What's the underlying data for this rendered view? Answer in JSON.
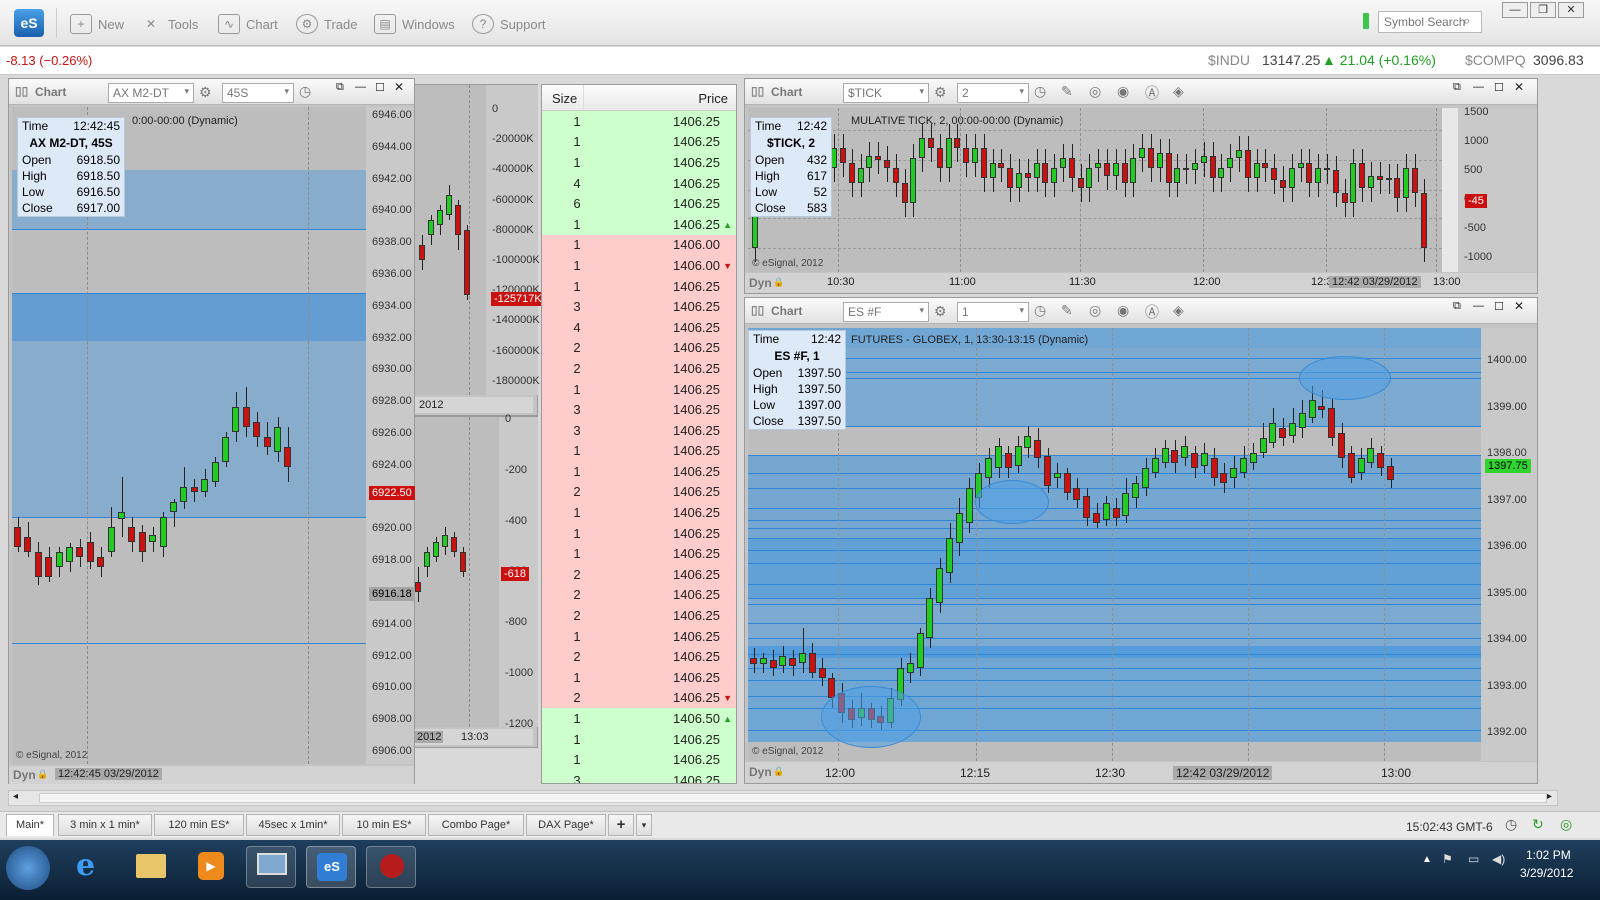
{
  "toolbar": {
    "logo": "eS",
    "buttons": [
      {
        "label": "New",
        "icon": "new-icon"
      },
      {
        "label": "Tools",
        "icon": "tools-icon"
      },
      {
        "label": "Chart",
        "icon": "chart-icon"
      },
      {
        "label": "Trade",
        "icon": "trade-icon"
      },
      {
        "label": "Windows",
        "icon": "windows-icon"
      },
      {
        "label": "Support",
        "icon": "support-icon"
      }
    ],
    "search_placeholder": "Symbol Search"
  },
  "ticker": {
    "left_change": "-8.13 (−0.26%)",
    "indu_symbol": "$INDU",
    "indu_value": "13147.25",
    "indu_change": "▲ 21.04 (+0.16%)",
    "compq_symbol": "$COMPQ",
    "compq_value": "3096.83"
  },
  "chart_left": {
    "header": "Chart",
    "symbol": "AX M2-DT",
    "interval": "45S",
    "subtitle": "0:00-00:00 (Dynamic)",
    "info": {
      "time_label": "Time",
      "time": "12:42:45",
      "title": "AX M2-DT, 45S",
      "open_label": "Open",
      "open": "6918.50",
      "high_label": "High",
      "high": "6918.50",
      "low_label": "Low",
      "low": "6916.50",
      "close_label": "Close",
      "close": "6917.00"
    },
    "y_ticks": [
      "6946.00",
      "6944.00",
      "6942.00",
      "6940.00",
      "6938.00",
      "6936.00",
      "6934.00",
      "6932.00",
      "6930.00",
      "6928.00",
      "6926.00",
      "6924.00",
      "6922.00",
      "6920.00",
      "6918.00",
      "6916.00",
      "6914.00",
      "6912.00",
      "6910.00",
      "6908.00",
      "6906.00"
    ],
    "last_price": "6922.50",
    "cursor_price": "6916.18",
    "copyright": "© eSignal, 2012",
    "dyn": "Dyn",
    "cursor_time": "12:42:45 03/29/2012"
  },
  "chart_mid_top": {
    "y_ticks": [
      "0",
      "-20000K",
      "-40000K",
      "-60000K",
      "-80000K",
      "-100000K",
      "-120000K",
      "-140000K",
      "-160000K",
      "-180000K"
    ],
    "last_value": "-125717K",
    "x_label": "2012"
  },
  "chart_mid_bottom": {
    "y_ticks": [
      "0",
      "-200",
      "-400",
      "-600",
      "-800",
      "-1000",
      "-1200"
    ],
    "last_value": "-618",
    "x_labels": [
      "2012",
      "13:03"
    ]
  },
  "dom": {
    "size_header": "Size",
    "price_header": "Price",
    "rows": [
      {
        "size": "1",
        "price": "1406.25",
        "side": "bid",
        "arrow": ""
      },
      {
        "size": "1",
        "price": "1406.25",
        "side": "bid",
        "arrow": ""
      },
      {
        "size": "1",
        "price": "1406.25",
        "side": "bid",
        "arrow": ""
      },
      {
        "size": "4",
        "price": "1406.25",
        "side": "bid",
        "arrow": ""
      },
      {
        "size": "6",
        "price": "1406.25",
        "side": "bid",
        "arrow": ""
      },
      {
        "size": "1",
        "price": "1406.25",
        "side": "bid",
        "arrow": "up"
      },
      {
        "size": "1",
        "price": "1406.00",
        "side": "ask",
        "arrow": ""
      },
      {
        "size": "1",
        "price": "1406.00",
        "side": "ask",
        "arrow": "down"
      },
      {
        "size": "1",
        "price": "1406.25",
        "side": "ask",
        "arrow": ""
      },
      {
        "size": "3",
        "price": "1406.25",
        "side": "ask",
        "arrow": ""
      },
      {
        "size": "4",
        "price": "1406.25",
        "side": "ask",
        "arrow": ""
      },
      {
        "size": "2",
        "price": "1406.25",
        "side": "ask",
        "arrow": ""
      },
      {
        "size": "2",
        "price": "1406.25",
        "side": "ask",
        "arrow": ""
      },
      {
        "size": "1",
        "price": "1406.25",
        "side": "ask",
        "arrow": ""
      },
      {
        "size": "3",
        "price": "1406.25",
        "side": "ask",
        "arrow": ""
      },
      {
        "size": "3",
        "price": "1406.25",
        "side": "ask",
        "arrow": ""
      },
      {
        "size": "1",
        "price": "1406.25",
        "side": "ask",
        "arrow": ""
      },
      {
        "size": "1",
        "price": "1406.25",
        "side": "ask",
        "arrow": ""
      },
      {
        "size": "2",
        "price": "1406.25",
        "side": "ask",
        "arrow": ""
      },
      {
        "size": "1",
        "price": "1406.25",
        "side": "ask",
        "arrow": ""
      },
      {
        "size": "1",
        "price": "1406.25",
        "side": "ask",
        "arrow": ""
      },
      {
        "size": "1",
        "price": "1406.25",
        "side": "ask",
        "arrow": ""
      },
      {
        "size": "2",
        "price": "1406.25",
        "side": "ask",
        "arrow": ""
      },
      {
        "size": "2",
        "price": "1406.25",
        "side": "ask",
        "arrow": ""
      },
      {
        "size": "2",
        "price": "1406.25",
        "side": "ask",
        "arrow": ""
      },
      {
        "size": "1",
        "price": "1406.25",
        "side": "ask",
        "arrow": ""
      },
      {
        "size": "2",
        "price": "1406.25",
        "side": "ask",
        "arrow": ""
      },
      {
        "size": "1",
        "price": "1406.25",
        "side": "ask",
        "arrow": ""
      },
      {
        "size": "2",
        "price": "1406.25",
        "side": "ask",
        "arrow": "down"
      },
      {
        "size": "1",
        "price": "1406.50",
        "side": "bid",
        "arrow": "up"
      },
      {
        "size": "1",
        "price": "1406.25",
        "side": "bid",
        "arrow": ""
      },
      {
        "size": "1",
        "price": "1406.25",
        "side": "bid",
        "arrow": ""
      },
      {
        "size": "3",
        "price": "1406.25",
        "side": "bid",
        "arrow": ""
      }
    ]
  },
  "chart_tick": {
    "header": "Chart",
    "symbol": "$TICK",
    "interval": "2",
    "subtitle": "MULATIVE TICK, 2, 00:00-00:00 (Dynamic)",
    "info": {
      "time_label": "Time",
      "time": "12:42",
      "title": "$TICK, 2",
      "open_label": "Open",
      "open": "432",
      "high_label": "High",
      "high": "617",
      "low_label": "Low",
      "low": "52",
      "close_label": "Close",
      "close": "583"
    },
    "y_ticks": [
      "1500",
      "1000",
      "500",
      "0",
      "-500",
      "-1000"
    ],
    "last_value": "-45",
    "x_ticks": [
      "10:30",
      "11:00",
      "11:30",
      "12:00",
      "12:3",
      "13:00"
    ],
    "cursor_time": "12:42 03/29/2012",
    "copyright": "© eSignal, 2012",
    "dyn": "Dyn"
  },
  "chart_es": {
    "header": "Chart",
    "symbol": "ES #F",
    "interval": "1",
    "subtitle": "FUTURES - GLOBEX, 1, 13:30-13:15 (Dynamic)",
    "info": {
      "time_label": "Time",
      "time": "12:42",
      "title": "ES #F, 1",
      "open_label": "Open",
      "open": "1397.50",
      "high_label": "High",
      "high": "1397.50",
      "low_label": "Low",
      "low": "1397.00",
      "close_label": "Close",
      "close": "1397.50"
    },
    "y_ticks": [
      "1400.00",
      "1399.00",
      "1398.00",
      "1397.00",
      "1396.00",
      "1395.00",
      "1394.00",
      "1393.00",
      "1392.00"
    ],
    "last_price": "1397.75",
    "x_ticks": [
      "12:00",
      "12:15",
      "12:30",
      "13:00"
    ],
    "cursor_time": "12:42 03/29/2012",
    "copyright": "© eSignal, 2012",
    "dyn": "Dyn"
  },
  "tabs": [
    "Main*",
    "3 min x 1 min*",
    "120 min ES*",
    "45sec x 1min*",
    "10 min ES*",
    "Combo Page*",
    "DAX Page*",
    "+"
  ],
  "status": {
    "clock": "15:02:43 GMT-6"
  },
  "taskbar": {
    "time": "1:02 PM",
    "date": "3/29/2012"
  },
  "colors": {
    "up": "#22cc22",
    "down": "#cc1111",
    "bid_row": "#ccffcc",
    "ask_row": "#ffcccc",
    "band": "#4696dc"
  }
}
